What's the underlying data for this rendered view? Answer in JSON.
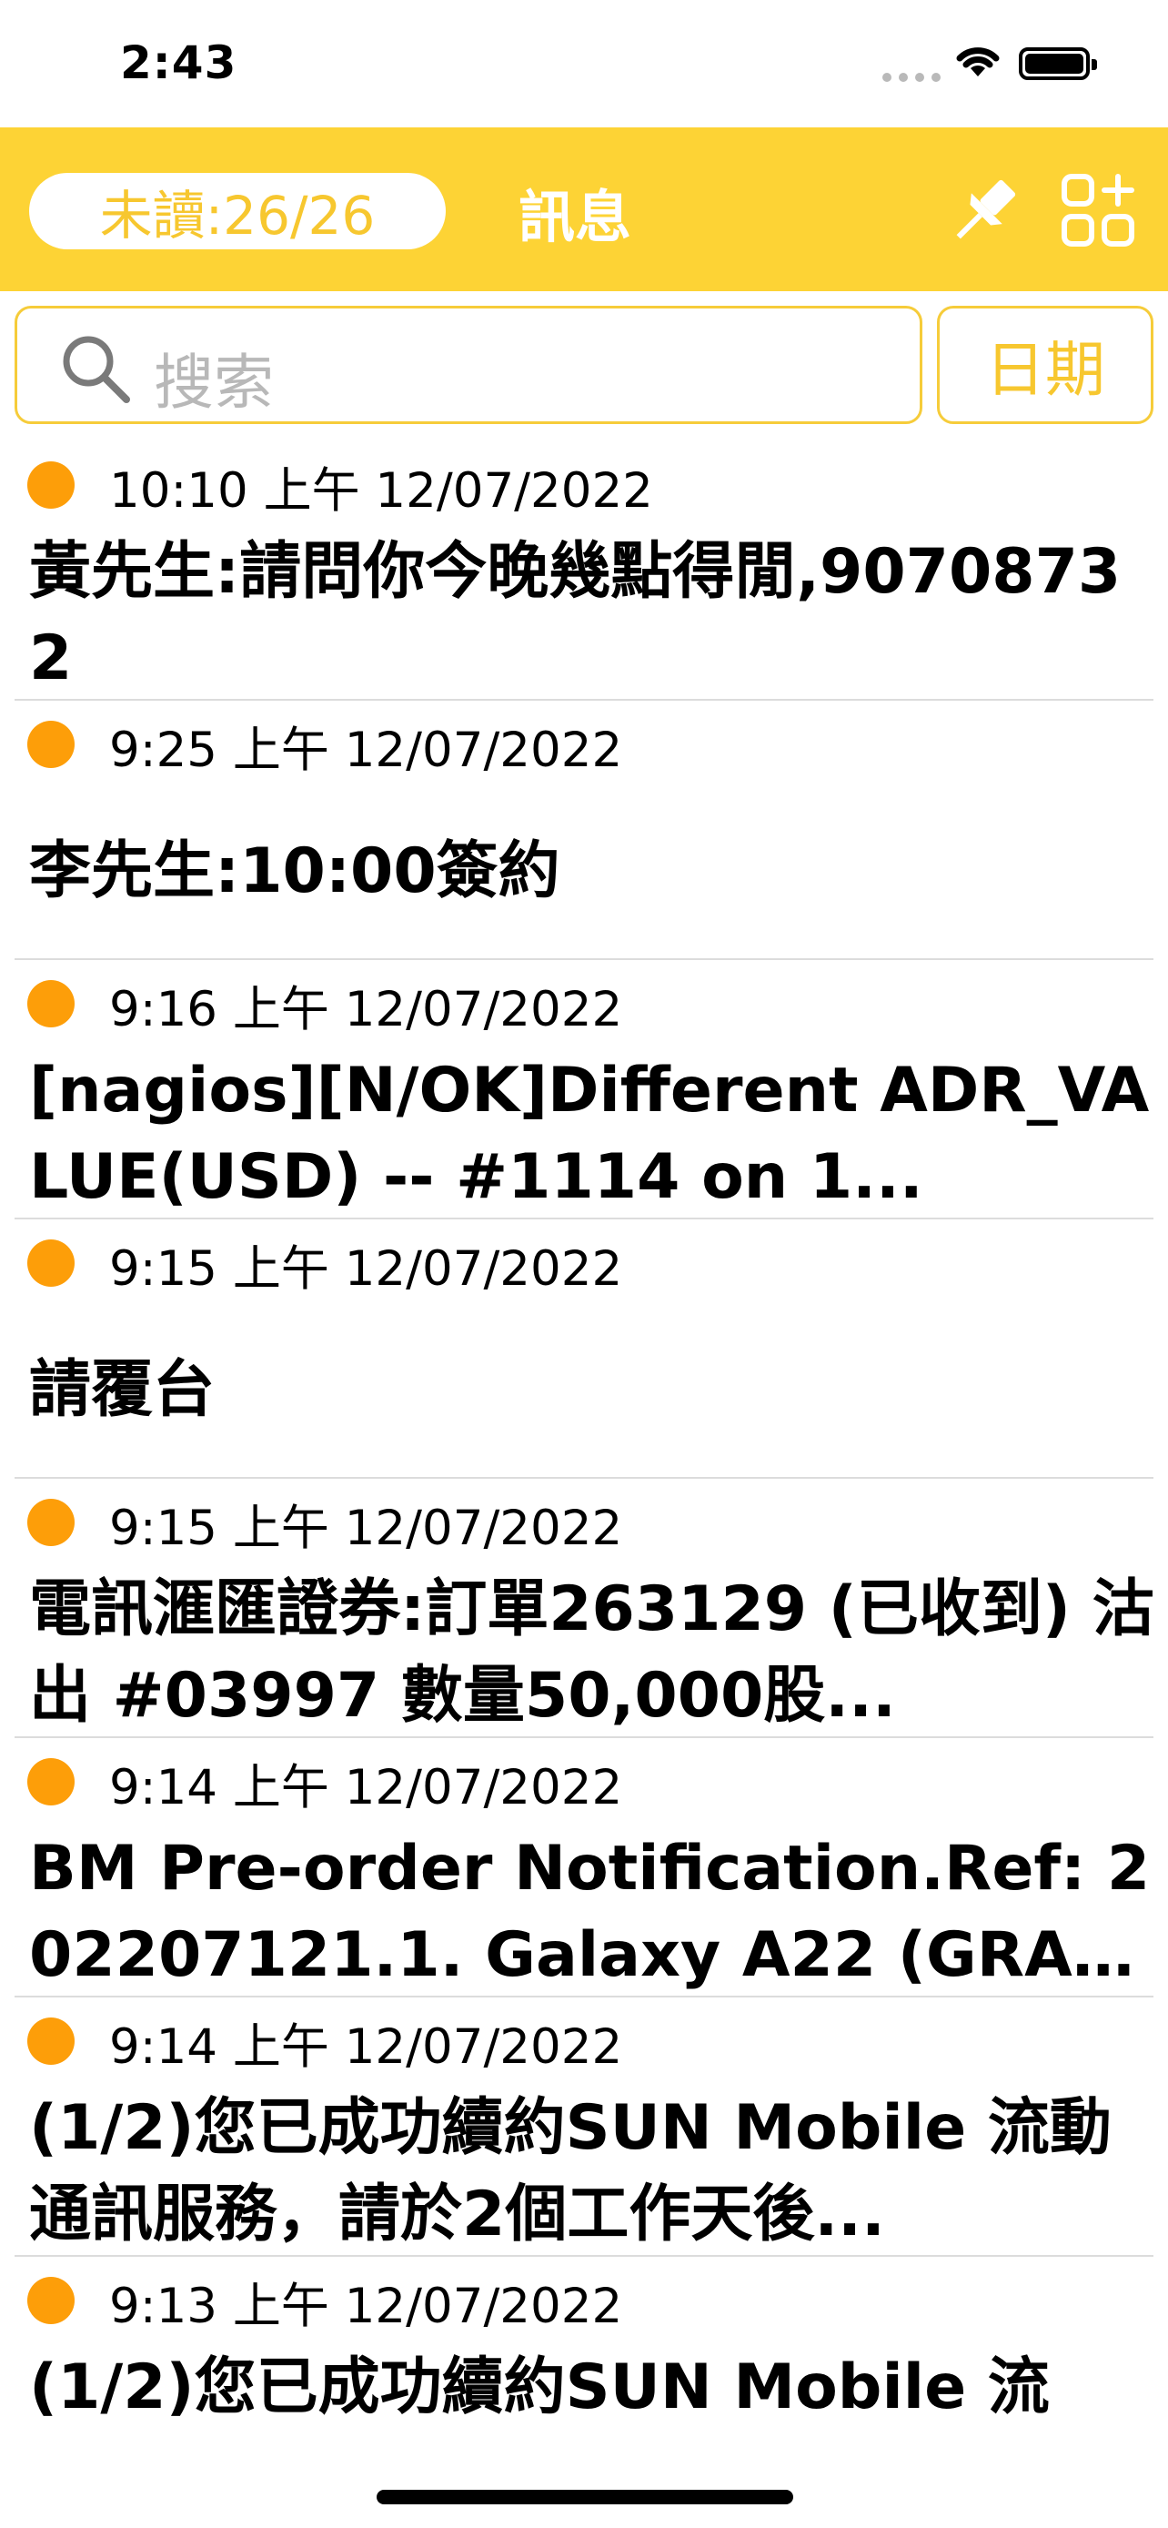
{
  "status_bar": {
    "time": "2:43"
  },
  "nav": {
    "unread": "未讀:26/26",
    "title": "訊息"
  },
  "search": {
    "placeholder": "搜索",
    "date_button": "日期"
  },
  "messages": [
    {
      "time": "10:10 上午 12/07/2022",
      "body": "黃先生:請問你今晚幾點得閒,90708732"
    },
    {
      "time": "9:25 上午 12/07/2022",
      "body": "李先生:10:00簽約"
    },
    {
      "time": "9:16 上午 12/07/2022",
      "body": "[nagios][N/OK]Different ADR_VALUE(USD) -- #1114 on 1..."
    },
    {
      "time": "9:15 上午 12/07/2022",
      "body": "請覆台"
    },
    {
      "time": "9:15 上午 12/07/2022",
      "body": "電訊滙匯證券:訂單263129 (已收到) 沽出 #03997 數量50,000股..."
    },
    {
      "time": "9:14 上午 12/07/2022",
      "body": " BM Pre-order Notification.Ref: 202207121.1. Galaxy A22 (GRAY..."
    },
    {
      "time": "9:14 上午 12/07/2022",
      "body": " (1/2)您已成功續約SUN Mobile 流動通訊服務，請於2個工作天後..."
    },
    {
      "time": "9:13 上午 12/07/2022",
      "body": " (1/2)您已成功續約SUN Mobile 流"
    }
  ],
  "colors": {
    "accent": "#fdd335",
    "dot": "#fd9e09",
    "accent_text": "#f7c72f"
  },
  "icons": [
    "search-icon",
    "pin-icon",
    "grid-add-icon",
    "wifi-icon",
    "battery-icon"
  ]
}
